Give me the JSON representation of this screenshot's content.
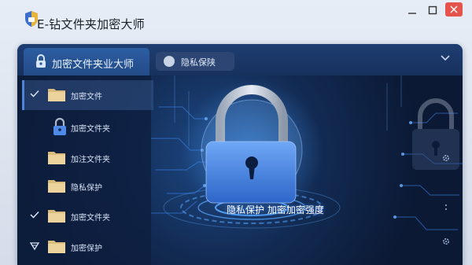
{
  "window": {
    "title": "E-钻文件夹加密大师",
    "controls": [
      "minimize",
      "maximize",
      "close"
    ],
    "close_color": "#e4534c"
  },
  "tabs": {
    "main_label": "加密文件夹业大师",
    "second_label": "隐私保陕",
    "expand_icon": "chevron-down-icon"
  },
  "sidebar": {
    "items": [
      {
        "label": "加密文件",
        "icon": "folder-icon",
        "marker": "check",
        "selected": true
      },
      {
        "label": "加密文件夹",
        "icon": "lock-icon",
        "marker": "none",
        "selected": false
      },
      {
        "label": "加注文件夹",
        "icon": "folder-icon",
        "marker": "none",
        "selected": false
      },
      {
        "label": "隐私保护",
        "icon": "folder-icon",
        "marker": "none",
        "selected": false
      },
      {
        "label": "加密文件夹",
        "icon": "folder-icon",
        "marker": "check",
        "selected": false
      },
      {
        "label": "加密保护",
        "icon": "folder-icon",
        "marker": "shield",
        "selected": false
      }
    ]
  },
  "main": {
    "caption": "隐私保护 加密加密强度",
    "accent": "#3f86ff",
    "lock_color": "#3d7fe0",
    "folder_color": "#e2c58a"
  }
}
